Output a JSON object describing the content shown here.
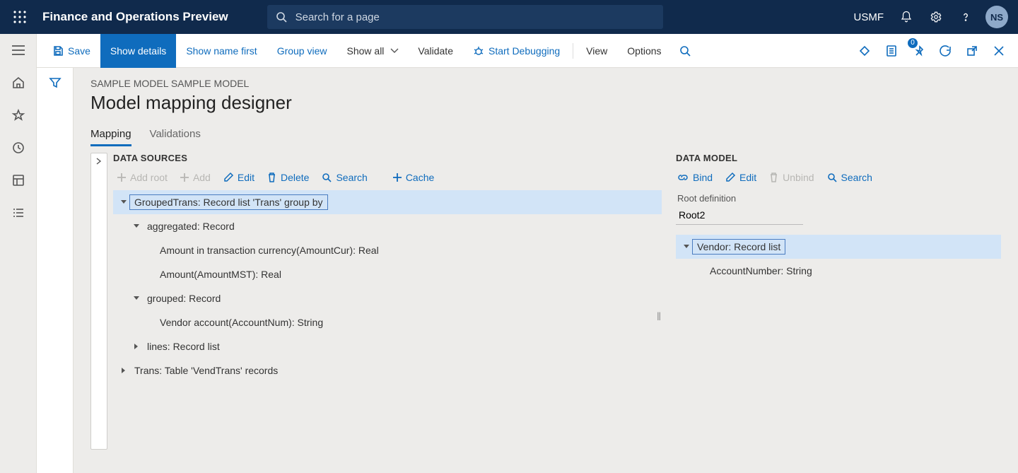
{
  "header": {
    "app_title": "Finance and Operations Preview",
    "search_placeholder": "Search for a page",
    "company": "USMF",
    "avatar_initials": "NS"
  },
  "actionbar": {
    "save": "Save",
    "show_details": "Show details",
    "show_name_first": "Show name first",
    "group_view": "Group view",
    "show_all": "Show all",
    "validate": "Validate",
    "start_debugging": "Start Debugging",
    "view": "View",
    "options": "Options",
    "badge_count": "0"
  },
  "page": {
    "breadcrumb": "SAMPLE MODEL SAMPLE MODEL",
    "title": "Model mapping designer",
    "tabs": {
      "mapping": "Mapping",
      "validations": "Validations"
    }
  },
  "datasources": {
    "title": "DATA SOURCES",
    "toolbar": {
      "add_root": "Add root",
      "add": "Add",
      "edit": "Edit",
      "delete": "Delete",
      "search": "Search",
      "cache": "Cache"
    },
    "tree": {
      "n0": "GroupedTrans: Record list 'Trans' group by",
      "n1": "aggregated: Record",
      "n2": "Amount in transaction currency(AmountCur): Real",
      "n3": "Amount(AmountMST): Real",
      "n4": "grouped: Record",
      "n5": "Vendor account(AccountNum): String",
      "n6": "lines: Record list",
      "n7": "Trans: Table 'VendTrans' records"
    }
  },
  "datamodel": {
    "title": "DATA MODEL",
    "toolbar": {
      "bind": "Bind",
      "edit": "Edit",
      "unbind": "Unbind",
      "search": "Search"
    },
    "root_def_label": "Root definition",
    "root_def_value": "Root2",
    "tree": {
      "n0": "Vendor: Record list",
      "n1": "AccountNumber: String"
    }
  }
}
